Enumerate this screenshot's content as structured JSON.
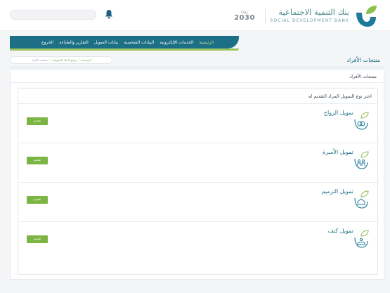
{
  "header": {
    "search_placeholder": "",
    "vision_year": "2030",
    "vision_text_top": "رؤية",
    "vision_text_bottom": "المملكة العربية السعودية",
    "bank_name_ar": "بنك التنمية الاجتماعية",
    "bank_name_en": "SOCIAL DEVELOPMENT BANK"
  },
  "nav": {
    "items": [
      {
        "label": "الرئيسية",
        "active": true
      },
      {
        "label": "الخدمات الإلكترونية",
        "active": false
      },
      {
        "label": "البيانات الشخصية",
        "active": false
      },
      {
        "label": "بيانات التمويل",
        "active": false
      },
      {
        "label": "التقارير والطباعة",
        "active": false
      },
      {
        "label": "الخروج",
        "active": false
      }
    ]
  },
  "breadcrumb": {
    "home": "الرئيسية",
    "sep1": "/",
    "programs": "برامج البنك التمويلية",
    "sep2": "/",
    "current": "منتجات الأفراد"
  },
  "page_title": "منتجات الأفراد",
  "card_title": "منتجات الأفراد",
  "prompt": "اختر نوع التمويل المراد التقديم له",
  "products": [
    {
      "name": "تمويل الزواج",
      "button": "تقديم",
      "icon": "rings-icon"
    },
    {
      "name": "تمويل الأسرة",
      "button": "تقديم",
      "icon": "family-icon"
    },
    {
      "name": "تمويل الترميم",
      "button": "تقديم",
      "icon": "house-repair-icon"
    },
    {
      "name": "تمويل كنف",
      "button": "تقديم",
      "icon": "care-icon"
    }
  ],
  "colors": {
    "primary": "#1d6f86",
    "accent_green": "#7db544",
    "nav_underline": "#9bc45c"
  }
}
